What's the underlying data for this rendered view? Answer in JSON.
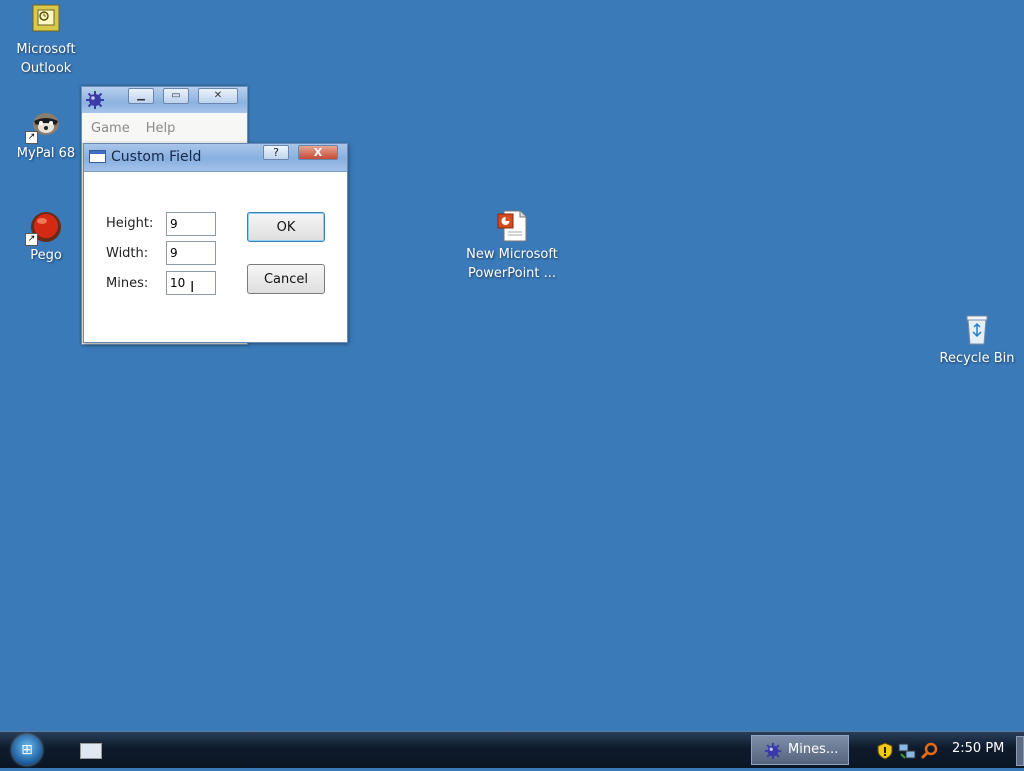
{
  "desktop": {
    "icons": [
      {
        "label": "Microsoft Outlook"
      },
      {
        "label": "MyPal 68"
      },
      {
        "label": "Pego"
      },
      {
        "label": "New Microsoft PowerPoint ..."
      },
      {
        "label": "Recycle Bin"
      }
    ]
  },
  "mines_window": {
    "menu": [
      "Game",
      "Help"
    ]
  },
  "dialog": {
    "title": "Custom Field",
    "help_label": "?",
    "close_label": "X",
    "fields": [
      {
        "label": "Height:",
        "value": "9"
      },
      {
        "label": "Width:",
        "value": "9"
      },
      {
        "label": "Mines:",
        "value": "10"
      }
    ],
    "ok_label": "OK",
    "cancel_label": "Cancel"
  },
  "taskbar": {
    "task_label": "Mines...",
    "clock": "2:50 PM"
  }
}
